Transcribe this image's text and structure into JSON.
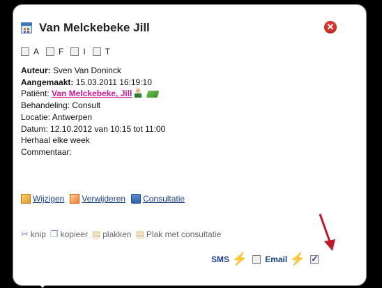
{
  "appointment": {
    "title": "Van Melckebeke Jill",
    "flags": [
      {
        "label": "A",
        "checked": false
      },
      {
        "label": "F",
        "checked": false
      },
      {
        "label": "I",
        "checked": false
      },
      {
        "label": "T",
        "checked": false
      }
    ],
    "auteur_label": "Auteur:",
    "auteur_value": " Sven Van Doninck",
    "aangemaakt_label": "Aangemaakt:",
    "aangemaakt_value": " 15.03.2011 16:19:10",
    "patient_label": "Patiënt: ",
    "patient_link": "Van Melckebeke, Jill",
    "behandeling": "Behandeling: Consult",
    "locatie": "Locatie: Antwerpen",
    "datum": "Datum: 12.10.2012 van 10:15 tot 11:00",
    "herhaal": "Herhaal elke week",
    "commentaar": "Commentaar:"
  },
  "actions": {
    "edit": "Wijzigen",
    "delete": "Verwijderen",
    "consult": "Consultatie"
  },
  "clipboard": {
    "cut": "knip",
    "copy": "kopieer",
    "paste": "plakken",
    "paste_consult": "Plak met consultatie"
  },
  "notify": {
    "sms": "SMS",
    "email": "Email",
    "sms_checked": false,
    "email_checked": true
  },
  "colors": {
    "accent_link": "#1a3e8e",
    "patient_link": "#d6168f",
    "close": "#d9362e",
    "bolt": "#f2b41c",
    "arrow": "#c0182a"
  }
}
